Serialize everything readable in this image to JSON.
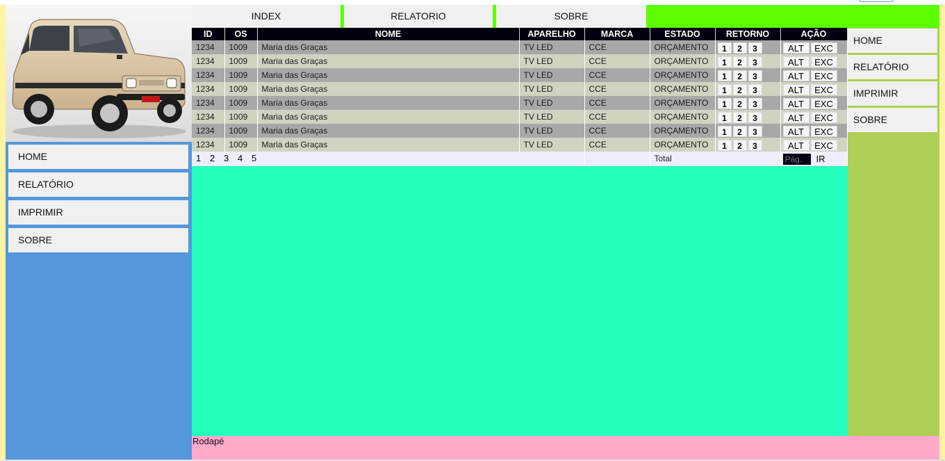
{
  "top_nav": {
    "tabs": [
      {
        "label": "INDEX"
      },
      {
        "label": "RELATORIO"
      },
      {
        "label": "SOBRE"
      }
    ]
  },
  "left_menu": {
    "items": [
      {
        "label": "HOME"
      },
      {
        "label": "RELATÓRIO"
      },
      {
        "label": "IMPRIMIR"
      },
      {
        "label": "SOBRE"
      }
    ]
  },
  "right_menu": {
    "items": [
      {
        "label": "HOME"
      },
      {
        "label": "RELATÓRIO"
      },
      {
        "label": "IMPRIMIR"
      },
      {
        "label": "SOBRE"
      }
    ]
  },
  "table": {
    "headers": [
      "ID",
      "OS",
      "NOME",
      "APARELHO",
      "MARCA",
      "ESTADO",
      "RETORNO",
      "AÇÃO"
    ],
    "rows": [
      {
        "id": "1234",
        "os": "1009",
        "nome": "Maria das Graças",
        "aparelho": "TV LED",
        "marca": "CCE",
        "estado": "ORÇAMENTO"
      },
      {
        "id": "1234",
        "os": "1009",
        "nome": "Maria das Graças",
        "aparelho": "TV LED",
        "marca": "CCE",
        "estado": "ORÇAMENTO"
      },
      {
        "id": "1234",
        "os": "1009",
        "nome": "Maria das Graças",
        "aparelho": "TV LED",
        "marca": "CCE",
        "estado": "ORÇAMENTO"
      },
      {
        "id": "1234",
        "os": "1009",
        "nome": "Maria das Graças",
        "aparelho": "TV LED",
        "marca": "CCE",
        "estado": "ORÇAMENTO"
      },
      {
        "id": "1234",
        "os": "1009",
        "nome": "Maria das Graças",
        "aparelho": "TV LED",
        "marca": "CCE",
        "estado": "ORÇAMENTO"
      },
      {
        "id": "1234",
        "os": "1009",
        "nome": "Maria das Graças",
        "aparelho": "TV LED",
        "marca": "CCE",
        "estado": "ORÇAMENTO"
      },
      {
        "id": "1234",
        "os": "1009",
        "nome": "Maria das Graças",
        "aparelho": "TV LED",
        "marca": "CCE",
        "estado": "ORÇAMENTO"
      },
      {
        "id": "1234",
        "os": "1009",
        "nome": "Maria das Graças",
        "aparelho": "TV LED",
        "marca": "CCE",
        "estado": "ORÇAMENTO"
      }
    ],
    "retorno_buttons": [
      "1",
      "2",
      "3"
    ],
    "acao_buttons": {
      "alt": "ALT",
      "exc": "EXC"
    },
    "pagination": [
      "1",
      "2",
      "3",
      "4",
      "5"
    ],
    "total_label": "Total",
    "page_input_placeholder": "Pág.",
    "go_label": "IR"
  },
  "footer": {
    "text": "Rodapé"
  },
  "colors": {
    "top_nav_bg": "#5cff00",
    "left_col_bg": "#5497dc",
    "main_bg": "#24ffbb",
    "right_col_bg": "#adcf55",
    "footer_bg": "#ffa9cb",
    "side_strip": "#fff2a3",
    "table_header_bg": "#000010",
    "row_odd": "#a8a8a8",
    "row_even": "#d0d3c0"
  },
  "icons": {
    "logo": "beige-car-photo"
  }
}
